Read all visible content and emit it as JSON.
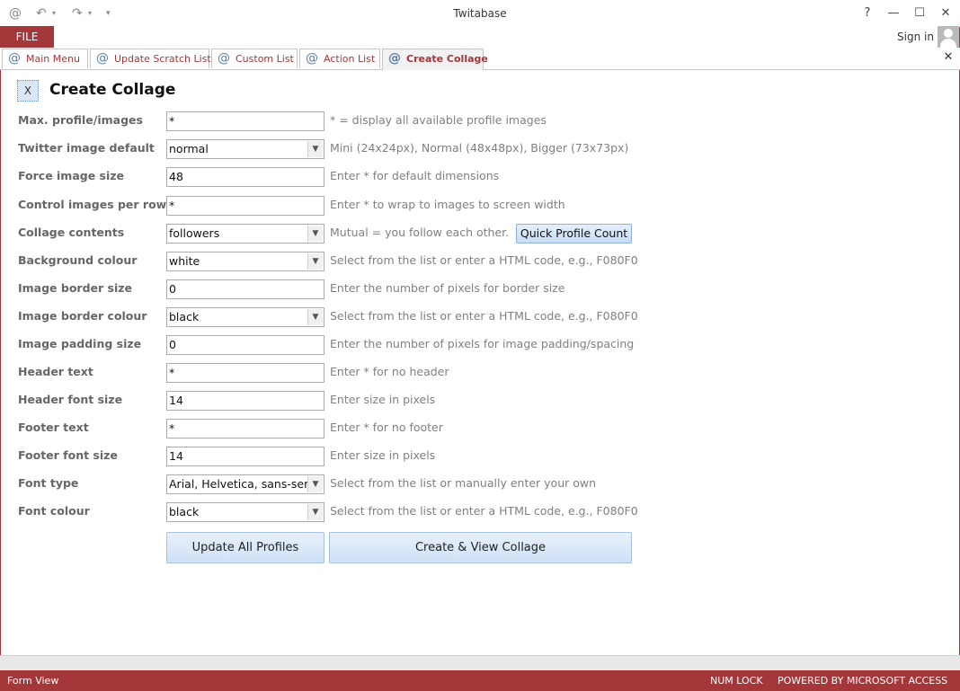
{
  "window": {
    "title": "Twitabase",
    "help": "?",
    "minimize": "—",
    "maximize": "☐",
    "close": "✕"
  },
  "ribbon": {
    "file_tab": "FILE",
    "sign_in": "Sign in"
  },
  "tabs": [
    {
      "label": "Main Menu",
      "active": false
    },
    {
      "label": "Update Scratch List",
      "active": false
    },
    {
      "label": "Custom List",
      "active": false
    },
    {
      "label": "Action List",
      "active": false
    },
    {
      "label": "Create Collage",
      "active": true
    }
  ],
  "tab_close": "✕",
  "form": {
    "close_button": "X",
    "title": "Create Collage",
    "rows": [
      {
        "label": "Max. profile/images",
        "value": "*",
        "hint": "* = display all available profile images"
      },
      {
        "label": "Twitter image default",
        "value": "normal",
        "hint": "Mini (24x24px), Normal (48x48px), Bigger (73x73px)"
      },
      {
        "label": "Force image size",
        "value": "48",
        "hint": "Enter * for default dimensions"
      },
      {
        "label": "Control images per row",
        "value": "*",
        "hint": "Enter * to wrap to images to screen width"
      },
      {
        "label": "Collage contents",
        "value": "followers",
        "hint": "Mutual = you follow each other."
      },
      {
        "label": "Background colour",
        "value": "white",
        "hint": "Select from the list or enter a HTML code, e.g., F080F0"
      },
      {
        "label": "Image border size",
        "value": "0",
        "hint": "Enter the number of pixels for border size"
      },
      {
        "label": "Image border colour",
        "value": "black",
        "hint": "Select from the list or enter a HTML code, e.g., F080F0"
      },
      {
        "label": "Image padding size",
        "value": "0",
        "hint": "Enter the number of pixels for image padding/spacing"
      },
      {
        "label": "Header text",
        "value": "*",
        "hint": "Enter * for no header"
      },
      {
        "label": "Header font size",
        "value": "14",
        "hint": "Enter size in pixels"
      },
      {
        "label": "Footer text",
        "value": "*",
        "hint": "Enter * for no footer"
      },
      {
        "label": "Footer font size",
        "value": "14",
        "hint": "Enter size in pixels"
      },
      {
        "label": "Font type",
        "value": "Arial, Helvetica, sans-serif",
        "hint": "Select from the list or manually enter your own"
      },
      {
        "label": "Font colour",
        "value": "black",
        "hint": "Select from the list or enter a HTML code, e.g., F080F0"
      }
    ],
    "quick_profile_count": "Quick Profile Count",
    "update_all_profiles": "Update All Profiles",
    "create_view_collage": "Create & View Collage"
  },
  "status": {
    "view": "Form View",
    "num_lock": "NUM LOCK",
    "powered_by": "POWERED BY MICROSOFT ACCESS"
  },
  "colors": {
    "accent": "#a4373a",
    "label": "#666666",
    "hint": "#808080",
    "button": "#cfe0f5"
  }
}
